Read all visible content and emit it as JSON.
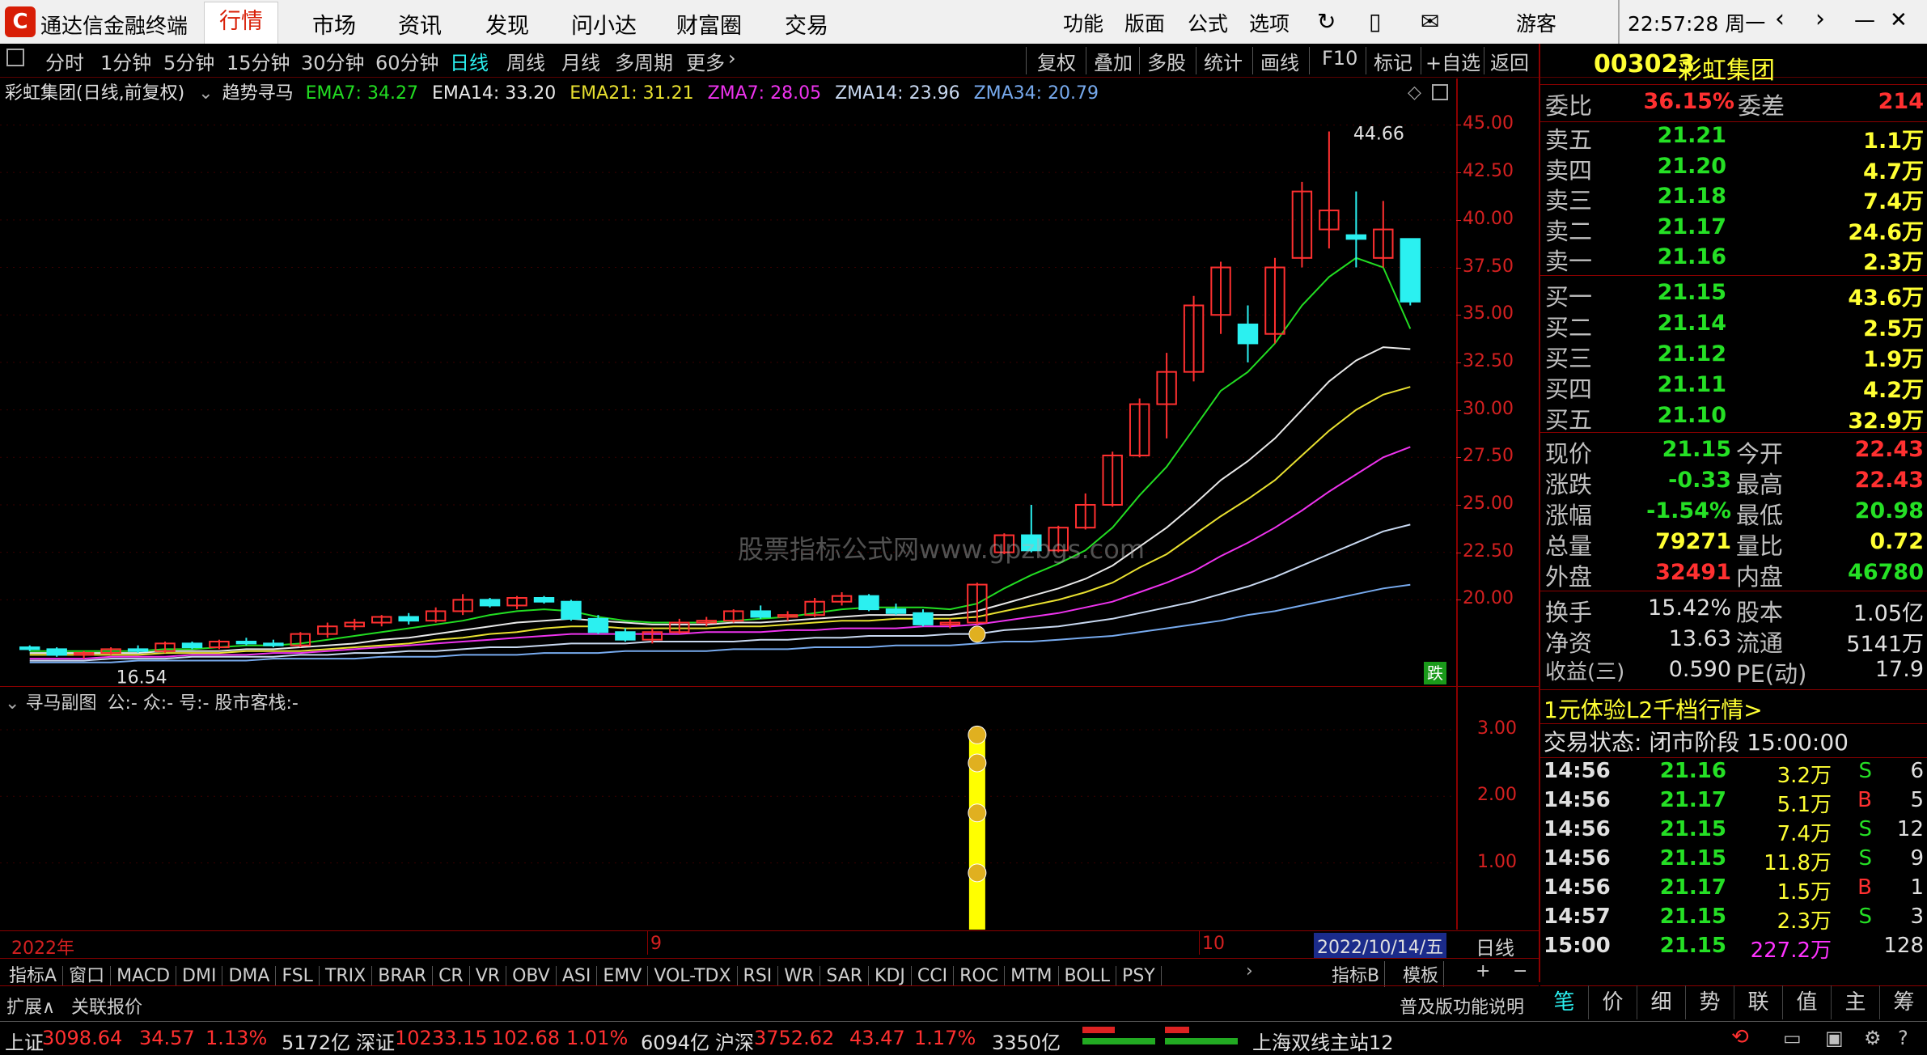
{
  "app": {
    "title": "通达信金融终端",
    "user": "游客",
    "clock": "22:57:28 周一"
  },
  "menu": [
    "行情",
    "市场",
    "资讯",
    "发现",
    "问小达",
    "财富圈",
    "交易"
  ],
  "topbar": [
    "功能",
    "版面",
    "公式",
    "选项"
  ],
  "periods": [
    "分时",
    "1分钟",
    "5分钟",
    "15分钟",
    "30分钟",
    "60分钟",
    "日线",
    "周线",
    "月线",
    "多周期",
    "更多"
  ],
  "periods_selected": "日线",
  "tools": [
    "复权",
    "叠加",
    "多股",
    "统计",
    "画线",
    "F10",
    "标记",
    "+自选",
    "返回"
  ],
  "legend": {
    "name": "彩虹集团(日线,前复权)",
    "indicator": "趋势寻马",
    "ema7": "EMA7: 34.27",
    "ema14": "EMA14: 33.20",
    "ema21": "EMA21: 31.21",
    "zma7": "ZMA7: 28.05",
    "zma14": "ZMA14: 23.96",
    "zma34": "ZMA34: 20.79"
  },
  "watermark": "股票指标公式网www.gpzbgs.com",
  "chart_data": {
    "type": "candlestick",
    "xlabel": "",
    "ylabel": "",
    "ylim": [
      15.5,
      46
    ],
    "yticks": [
      "45.00",
      "42.50",
      "40.00",
      "37.50",
      "35.00",
      "32.50",
      "30.00",
      "27.50",
      "25.00",
      "22.50",
      "20.00"
    ],
    "high_label": "44.66",
    "low_label": "16.54",
    "fall_tag": "跌",
    "candles": [
      [
        17.5,
        17.6,
        17.3,
        17.4
      ],
      [
        17.4,
        17.5,
        17.0,
        17.1
      ],
      [
        17.1,
        17.3,
        16.9,
        17.2
      ],
      [
        17.2,
        17.5,
        17.1,
        17.4
      ],
      [
        17.4,
        17.6,
        17.2,
        17.3
      ],
      [
        17.3,
        17.8,
        17.2,
        17.7
      ],
      [
        17.7,
        17.8,
        17.4,
        17.5
      ],
      [
        17.5,
        17.9,
        17.4,
        17.8
      ],
      [
        17.8,
        18.0,
        17.6,
        17.7
      ],
      [
        17.7,
        17.9,
        17.5,
        17.6
      ],
      [
        17.6,
        18.3,
        17.5,
        18.2
      ],
      [
        18.2,
        18.8,
        18.0,
        18.6
      ],
      [
        18.6,
        19.0,
        18.4,
        18.8
      ],
      [
        18.8,
        19.2,
        18.6,
        19.1
      ],
      [
        19.1,
        19.3,
        18.7,
        18.9
      ],
      [
        18.9,
        19.6,
        18.8,
        19.4
      ],
      [
        19.4,
        20.3,
        19.2,
        20.0
      ],
      [
        20.0,
        20.1,
        19.6,
        19.7
      ],
      [
        19.7,
        20.2,
        19.5,
        20.1
      ],
      [
        20.1,
        20.2,
        19.8,
        19.9
      ],
      [
        19.9,
        20.0,
        18.9,
        19.0
      ],
      [
        19.0,
        19.2,
        18.2,
        18.3
      ],
      [
        18.3,
        18.5,
        17.8,
        17.9
      ],
      [
        17.9,
        18.5,
        17.7,
        18.3
      ],
      [
        18.3,
        19.0,
        18.2,
        18.8
      ],
      [
        18.8,
        19.1,
        18.6,
        18.9
      ],
      [
        18.9,
        19.5,
        18.8,
        19.4
      ],
      [
        19.4,
        19.7,
        19.0,
        19.1
      ],
      [
        19.1,
        19.4,
        18.9,
        19.2
      ],
      [
        19.2,
        20.1,
        19.1,
        19.9
      ],
      [
        19.9,
        20.4,
        19.7,
        20.2
      ],
      [
        20.2,
        20.3,
        19.4,
        19.5
      ],
      [
        19.5,
        19.8,
        19.2,
        19.3
      ],
      [
        19.3,
        19.5,
        18.6,
        18.7
      ],
      [
        18.7,
        19.0,
        18.5,
        18.8
      ],
      [
        18.8,
        20.9,
        18.7,
        20.8
      ],
      [
        22.5,
        23.5,
        22.4,
        23.4
      ],
      [
        23.4,
        25.0,
        22.5,
        22.6
      ],
      [
        22.6,
        23.9,
        22.5,
        23.8
      ],
      [
        23.8,
        25.6,
        23.7,
        25.0
      ],
      [
        25.0,
        27.8,
        24.9,
        27.6
      ],
      [
        27.6,
        30.6,
        27.5,
        30.3
      ],
      [
        30.3,
        33.0,
        28.5,
        32.0
      ],
      [
        32.0,
        36.0,
        31.5,
        35.5
      ],
      [
        35.0,
        37.8,
        34.0,
        37.5
      ],
      [
        34.5,
        35.5,
        32.5,
        33.5
      ],
      [
        34.0,
        38.0,
        33.5,
        37.5
      ],
      [
        38.0,
        42.0,
        37.5,
        41.5
      ],
      [
        39.5,
        44.66,
        38.5,
        40.5
      ],
      [
        39.2,
        41.5,
        37.5,
        39.0
      ],
      [
        38.0,
        41.0,
        37.5,
        39.5
      ],
      [
        39.0,
        38.0,
        35.5,
        35.7
      ]
    ],
    "series": [
      {
        "name": "EMA7",
        "color": "#22dd22",
        "values": [
          17.3,
          17.3,
          17.3,
          17.3,
          17.3,
          17.4,
          17.4,
          17.5,
          17.6,
          17.6,
          17.7,
          17.9,
          18.1,
          18.3,
          18.5,
          18.7,
          18.9,
          19.2,
          19.4,
          19.5,
          19.4,
          19.1,
          18.9,
          18.8,
          18.8,
          18.8,
          18.9,
          19.0,
          19.1,
          19.3,
          19.5,
          19.6,
          19.6,
          19.6,
          19.5,
          19.8,
          20.6,
          21.3,
          21.9,
          22.6,
          23.8,
          25.5,
          27.0,
          29.0,
          31.0,
          32.0,
          33.5,
          35.5,
          37.0,
          38.0,
          37.5,
          34.27
        ]
      },
      {
        "name": "EMA14",
        "color": "#e8e8e8",
        "values": [
          17.2,
          17.2,
          17.2,
          17.2,
          17.2,
          17.3,
          17.3,
          17.3,
          17.4,
          17.4,
          17.5,
          17.6,
          17.7,
          17.9,
          18.0,
          18.2,
          18.4,
          18.6,
          18.8,
          18.9,
          19.0,
          18.9,
          18.8,
          18.7,
          18.7,
          18.7,
          18.8,
          18.8,
          18.9,
          19.0,
          19.1,
          19.2,
          19.2,
          19.2,
          19.2,
          19.4,
          19.8,
          20.2,
          20.6,
          21.1,
          21.8,
          22.8,
          23.8,
          25.0,
          26.3,
          27.3,
          28.5,
          30.0,
          31.5,
          32.6,
          33.3,
          33.2
        ]
      },
      {
        "name": "EMA21",
        "color": "#e8e030",
        "values": [
          17.1,
          17.1,
          17.1,
          17.1,
          17.1,
          17.2,
          17.2,
          17.2,
          17.3,
          17.3,
          17.3,
          17.4,
          17.5,
          17.6,
          17.7,
          17.9,
          18.0,
          18.2,
          18.3,
          18.5,
          18.6,
          18.6,
          18.5,
          18.5,
          18.5,
          18.5,
          18.6,
          18.6,
          18.7,
          18.8,
          18.9,
          18.9,
          19.0,
          19.0,
          19.0,
          19.1,
          19.4,
          19.7,
          20.0,
          20.4,
          20.9,
          21.7,
          22.4,
          23.4,
          24.4,
          25.3,
          26.3,
          27.6,
          28.9,
          30.0,
          30.8,
          31.21
        ]
      },
      {
        "name": "ZMA7",
        "color": "#ee33ee",
        "values": [
          16.9,
          16.9,
          16.9,
          17.0,
          17.0,
          17.0,
          17.1,
          17.1,
          17.1,
          17.2,
          17.2,
          17.3,
          17.4,
          17.5,
          17.6,
          17.7,
          17.8,
          17.9,
          18.0,
          18.1,
          18.2,
          18.2,
          18.2,
          18.2,
          18.2,
          18.3,
          18.3,
          18.3,
          18.4,
          18.4,
          18.5,
          18.5,
          18.5,
          18.6,
          18.6,
          18.7,
          18.9,
          19.1,
          19.3,
          19.6,
          19.9,
          20.4,
          20.9,
          21.5,
          22.3,
          23.0,
          23.8,
          24.7,
          25.7,
          26.6,
          27.5,
          28.05
        ]
      },
      {
        "name": "ZMA14",
        "color": "#c8d8f0",
        "values": [
          16.8,
          16.8,
          16.8,
          16.9,
          16.9,
          16.9,
          17.0,
          17.0,
          17.0,
          17.0,
          17.1,
          17.1,
          17.2,
          17.2,
          17.3,
          17.3,
          17.4,
          17.5,
          17.5,
          17.6,
          17.7,
          17.7,
          17.7,
          17.8,
          17.8,
          17.8,
          17.8,
          17.9,
          17.9,
          18.0,
          18.0,
          18.1,
          18.1,
          18.1,
          18.2,
          18.2,
          18.4,
          18.5,
          18.6,
          18.8,
          19.0,
          19.3,
          19.6,
          19.9,
          20.3,
          20.7,
          21.2,
          21.8,
          22.4,
          23.0,
          23.6,
          23.96
        ]
      },
      {
        "name": "ZMA34",
        "color": "#77aaee",
        "values": [
          16.7,
          16.7,
          16.7,
          16.7,
          16.8,
          16.8,
          16.8,
          16.8,
          16.8,
          16.9,
          16.9,
          16.9,
          16.9,
          17.0,
          17.0,
          17.0,
          17.1,
          17.1,
          17.1,
          17.2,
          17.2,
          17.2,
          17.3,
          17.3,
          17.3,
          17.3,
          17.4,
          17.4,
          17.4,
          17.5,
          17.5,
          17.5,
          17.6,
          17.6,
          17.6,
          17.7,
          17.8,
          17.8,
          17.9,
          18.0,
          18.1,
          18.3,
          18.5,
          18.7,
          18.9,
          19.2,
          19.4,
          19.7,
          20.0,
          20.3,
          20.6,
          20.79
        ]
      }
    ],
    "signal_candle_index": 35,
    "sub": {
      "ylim": [
        0,
        3.4
      ],
      "yticks": [
        "3.00",
        "2.00",
        "1.00"
      ],
      "bar_value": 3.0,
      "bar_index": 35
    }
  },
  "sublegend": {
    "name": "寻马副图",
    "text": "公:- 众:- 号:- 股市客栈:-"
  },
  "xaxis": {
    "y": "2022年",
    "m9": "9",
    "m10": "10",
    "date": "2022/10/14/五",
    "period": "日线"
  },
  "tabs": [
    "指标A",
    "窗口",
    "MACD",
    "DMI",
    "DMA",
    "FSL",
    "TRIX",
    "BRAR",
    "CR",
    "VR",
    "OBV",
    "ASI",
    "EMV",
    "VOL-TDX",
    "RSI",
    "WR",
    "SAR",
    "KDJ",
    "CCI",
    "ROC",
    "MTM",
    "BOLL",
    "PSY"
  ],
  "tabs_right": [
    "指标B",
    "模板",
    "+",
    "−"
  ],
  "ext": {
    "a": "扩展∧",
    "b": "关联报价",
    "c": "普及版功能说明"
  },
  "quote": {
    "code": "003023",
    "name": "彩虹集团",
    "wb": {
      "l": "委比",
      "v": "36.15%",
      "l2": "委差",
      "v2": "214"
    },
    "sells": [
      {
        "l": "卖五",
        "p": "21.21",
        "v": "1.1万"
      },
      {
        "l": "卖四",
        "p": "21.20",
        "v": "4.7万"
      },
      {
        "l": "卖三",
        "p": "21.18",
        "v": "7.4万"
      },
      {
        "l": "卖二",
        "p": "21.17",
        "v": "24.6万"
      },
      {
        "l": "卖一",
        "p": "21.16",
        "v": "2.3万"
      }
    ],
    "buys": [
      {
        "l": "买一",
        "p": "21.15",
        "v": "43.6万"
      },
      {
        "l": "买二",
        "p": "21.14",
        "v": "2.5万"
      },
      {
        "l": "买三",
        "p": "21.12",
        "v": "1.9万"
      },
      {
        "l": "买四",
        "p": "21.11",
        "v": "4.2万"
      },
      {
        "l": "买五",
        "p": "21.10",
        "v": "32.9万"
      }
    ],
    "stats": [
      {
        "l": "现价",
        "v": "21.15",
        "l2": "今开",
        "v2": "22.43"
      },
      {
        "l": "涨跌",
        "v": "-0.33",
        "l2": "最高",
        "v2": "22.43"
      },
      {
        "l": "涨幅",
        "v": "-1.54%",
        "l2": "最低",
        "v2": "20.98"
      },
      {
        "l": "总量",
        "v": "79271",
        "l2": "量比",
        "v2": "0.72"
      },
      {
        "l": "外盘",
        "v": "32491",
        "l2": "内盘",
        "v2": "46780"
      }
    ],
    "fund": [
      {
        "l": "换手",
        "v": "15.42%",
        "l2": "股本",
        "v2": "1.05亿"
      },
      {
        "l": "净资",
        "v": "13.63",
        "l2": "流通",
        "v2": "5141万"
      },
      {
        "l": "收益(三)",
        "v": "0.590",
        "l2": "PE(动)",
        "v2": "17.9"
      }
    ],
    "promo": "1元体验L2千档行情>",
    "state": "交易状态: 闭市阶段 15:00:00",
    "ticks": [
      {
        "t": "14:56",
        "p": "21.16",
        "v": "3.2万",
        "d": "S",
        "n": "6"
      },
      {
        "t": "14:56",
        "p": "21.17",
        "v": "5.1万",
        "d": "B",
        "n": "5"
      },
      {
        "t": "14:56",
        "p": "21.15",
        "v": "7.4万",
        "d": "S",
        "n": "12"
      },
      {
        "t": "14:56",
        "p": "21.15",
        "v": "11.8万",
        "d": "S",
        "n": "9"
      },
      {
        "t": "14:56",
        "p": "21.17",
        "v": "1.5万",
        "d": "B",
        "n": "1"
      },
      {
        "t": "14:57",
        "p": "21.15",
        "v": "2.3万",
        "d": "S",
        "n": "3"
      },
      {
        "t": "15:00",
        "p": "21.15",
        "v": "227.2万",
        "d": "",
        "n": "128"
      }
    ],
    "bottomtabs": [
      "笔",
      "价",
      "细",
      "势",
      "联",
      "值",
      "主",
      "筹"
    ]
  },
  "status": {
    "sh": "上证",
    "shv": "3098.64",
    "shc": "34.57",
    "shp": "1.13%",
    "sha": "5172亿",
    "sz": "深证",
    "szv": "10233.15",
    "szc": "102.68",
    "szp": "1.01%",
    "sza": "6094亿",
    "hs": "沪深",
    "hsv": "3752.62",
    "hsc": "43.47",
    "hsp": "1.17%",
    "hsa": "3350亿",
    "server": "上海双线主站12"
  }
}
